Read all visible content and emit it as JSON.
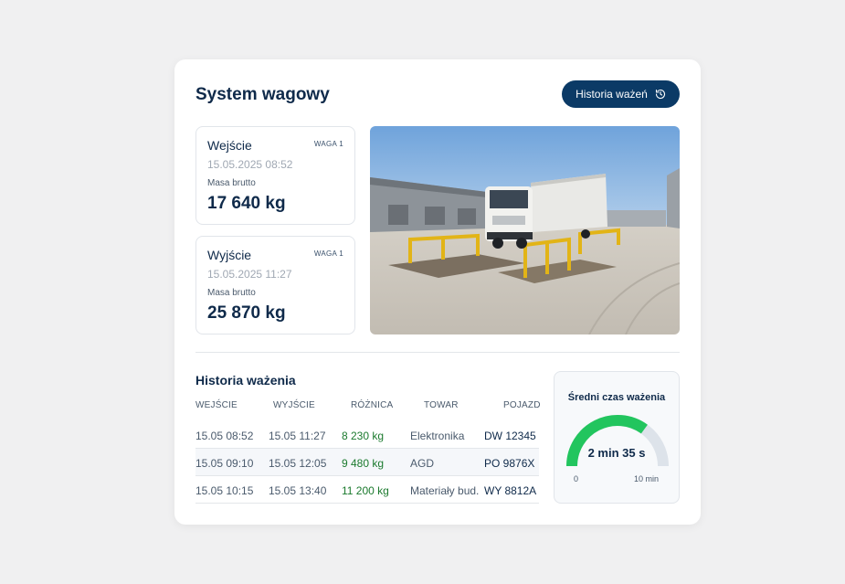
{
  "header": {
    "title": "System wagowy",
    "history_button": "Historia ważeń",
    "history_icon": "history-icon"
  },
  "entry": {
    "title": "Wejście",
    "tag": "WAGA 1",
    "date": "15.05.2025 08:52",
    "mass_label": "Masa brutto",
    "mass": "17 640 kg"
  },
  "exit": {
    "title": "Wyjście",
    "tag": "WAGA 1",
    "date": "15.05.2025 11:27",
    "mass_label": "Masa brutto",
    "mass": "25 870 kg"
  },
  "history": {
    "title": "Historia ważenia",
    "columns": [
      "WEJŚCIE",
      "WYJŚCIE",
      "RÓŻNICA",
      "TOWAR",
      "POJAZD"
    ],
    "rows": [
      {
        "in": "15.05 08:52",
        "out": "15.05 11:27",
        "diff": "8 230 kg",
        "goods": "Elektronika",
        "vehicle": "DW 12345"
      },
      {
        "in": "15.05 09:10",
        "out": "15.05 12:05",
        "diff": "9 480 kg",
        "goods": "AGD",
        "vehicle": "PO 9876X"
      },
      {
        "in": "15.05 10:15",
        "out": "15.05 13:40",
        "diff": "11 200 kg",
        "goods": "Materiały bud.",
        "vehicle": "WY 8812A"
      }
    ]
  },
  "average": {
    "title": "Średni czas ważenia",
    "value": "2 min 35 s",
    "min_label": "0",
    "max_label": "10 min",
    "fraction": 0.7,
    "fill_color": "#22c55e",
    "track_color": "#dde3ea"
  },
  "colors": {
    "primary": "#0b3a66",
    "positive": "#1b7a2e"
  }
}
